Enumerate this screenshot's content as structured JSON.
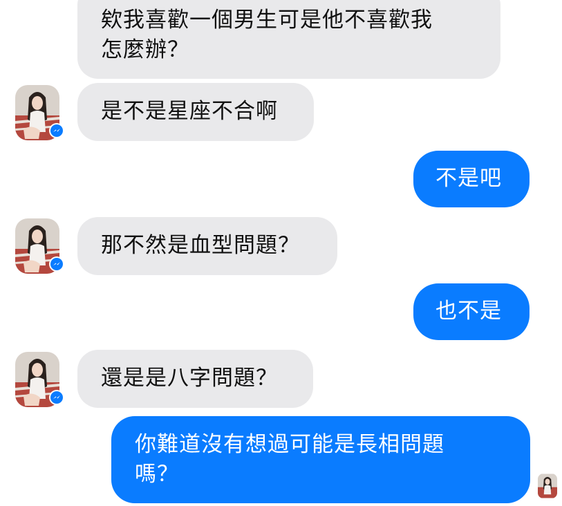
{
  "messages": [
    {
      "id": "b1",
      "side": "incoming",
      "text": "欸我喜歡一個男生可是他不喜歡我\n怎麼辦？"
    },
    {
      "id": "b2",
      "side": "incoming",
      "text": "是不是星座不合啊"
    },
    {
      "id": "b3",
      "side": "outgoing",
      "text": "不是吧"
    },
    {
      "id": "b4",
      "side": "incoming",
      "text": "那不然是血型問題？"
    },
    {
      "id": "b5",
      "side": "outgoing",
      "text": "也不是"
    },
    {
      "id": "b6",
      "side": "incoming",
      "text": "還是是八字問題？"
    },
    {
      "id": "b7",
      "side": "outgoing",
      "text": "你難道沒有想過可能是長相問題\n嗎？"
    }
  ],
  "colors": {
    "incoming_bubble": "#e9e9eb",
    "outgoing_bubble": "#0a7cff",
    "messenger_badge": "#0a7cff"
  },
  "icons": {
    "contact_avatar": "contact-avatar-photo",
    "badge": "messenger-icon",
    "read_receipt": "seen-avatar"
  }
}
